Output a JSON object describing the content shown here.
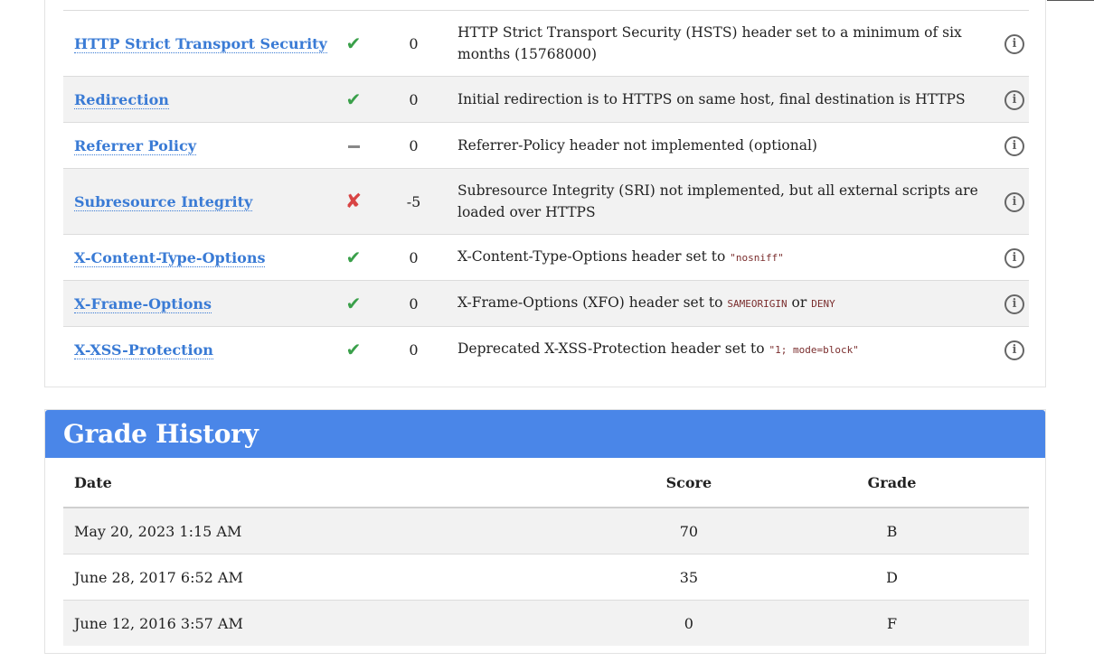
{
  "tests": [
    {
      "name": "HTTP Strict Transport Security",
      "pass": "check",
      "score": "0",
      "reason_parts": [
        "HTTP Strict Transport Security (HSTS) header set to a minimum of six months (15768000)"
      ],
      "code": []
    },
    {
      "name": "Redirection",
      "pass": "check",
      "score": "0",
      "reason_parts": [
        "Initial redirection is to HTTPS on same host, final destination is HTTPS"
      ],
      "code": []
    },
    {
      "name": "Referrer Policy",
      "pass": "dash",
      "score": "0",
      "reason_parts": [
        "Referrer-Policy header not implemented (optional)"
      ],
      "code": []
    },
    {
      "name": "Subresource Integrity",
      "pass": "cross",
      "score": "-5",
      "reason_parts": [
        "Subresource Integrity (SRI) not implemented, but all external scripts are loaded over HTTPS"
      ],
      "code": []
    },
    {
      "name": "X-Content-Type-Options",
      "pass": "check",
      "score": "0",
      "reason_parts": [
        "X-Content-Type-Options header set to "
      ],
      "code": [
        "\"nosniff\""
      ]
    },
    {
      "name": "X-Frame-Options",
      "pass": "check",
      "score": "0",
      "reason_parts": [
        "X-Frame-Options (XFO) header set to ",
        " or "
      ],
      "code": [
        "SAMEORIGIN",
        "DENY"
      ]
    },
    {
      "name": "X-XSS-Protection",
      "pass": "check",
      "score": "0",
      "reason_parts": [
        "Deprecated X-XSS-Protection header set to "
      ],
      "code": [
        "\"1; mode=block\""
      ]
    }
  ],
  "history": {
    "title": "Grade History",
    "headers": {
      "date": "Date",
      "score": "Score",
      "grade": "Grade"
    },
    "rows": [
      {
        "date": "May 20, 2023 1:15 AM",
        "score": "70",
        "grade": "B"
      },
      {
        "date": "June 28, 2017 6:52 AM",
        "score": "35",
        "grade": "D"
      },
      {
        "date": "June 12, 2016 3:57 AM",
        "score": "0",
        "grade": "F"
      }
    ]
  },
  "icons": {
    "info": "info-icon",
    "pass": "checkmark-icon",
    "fail": "cross-icon",
    "neutral": "dash-icon"
  },
  "colors": {
    "link": "#3a7bd5",
    "header_bg": "#4a86e8",
    "pass": "#3aa04a",
    "fail": "#d84444"
  }
}
